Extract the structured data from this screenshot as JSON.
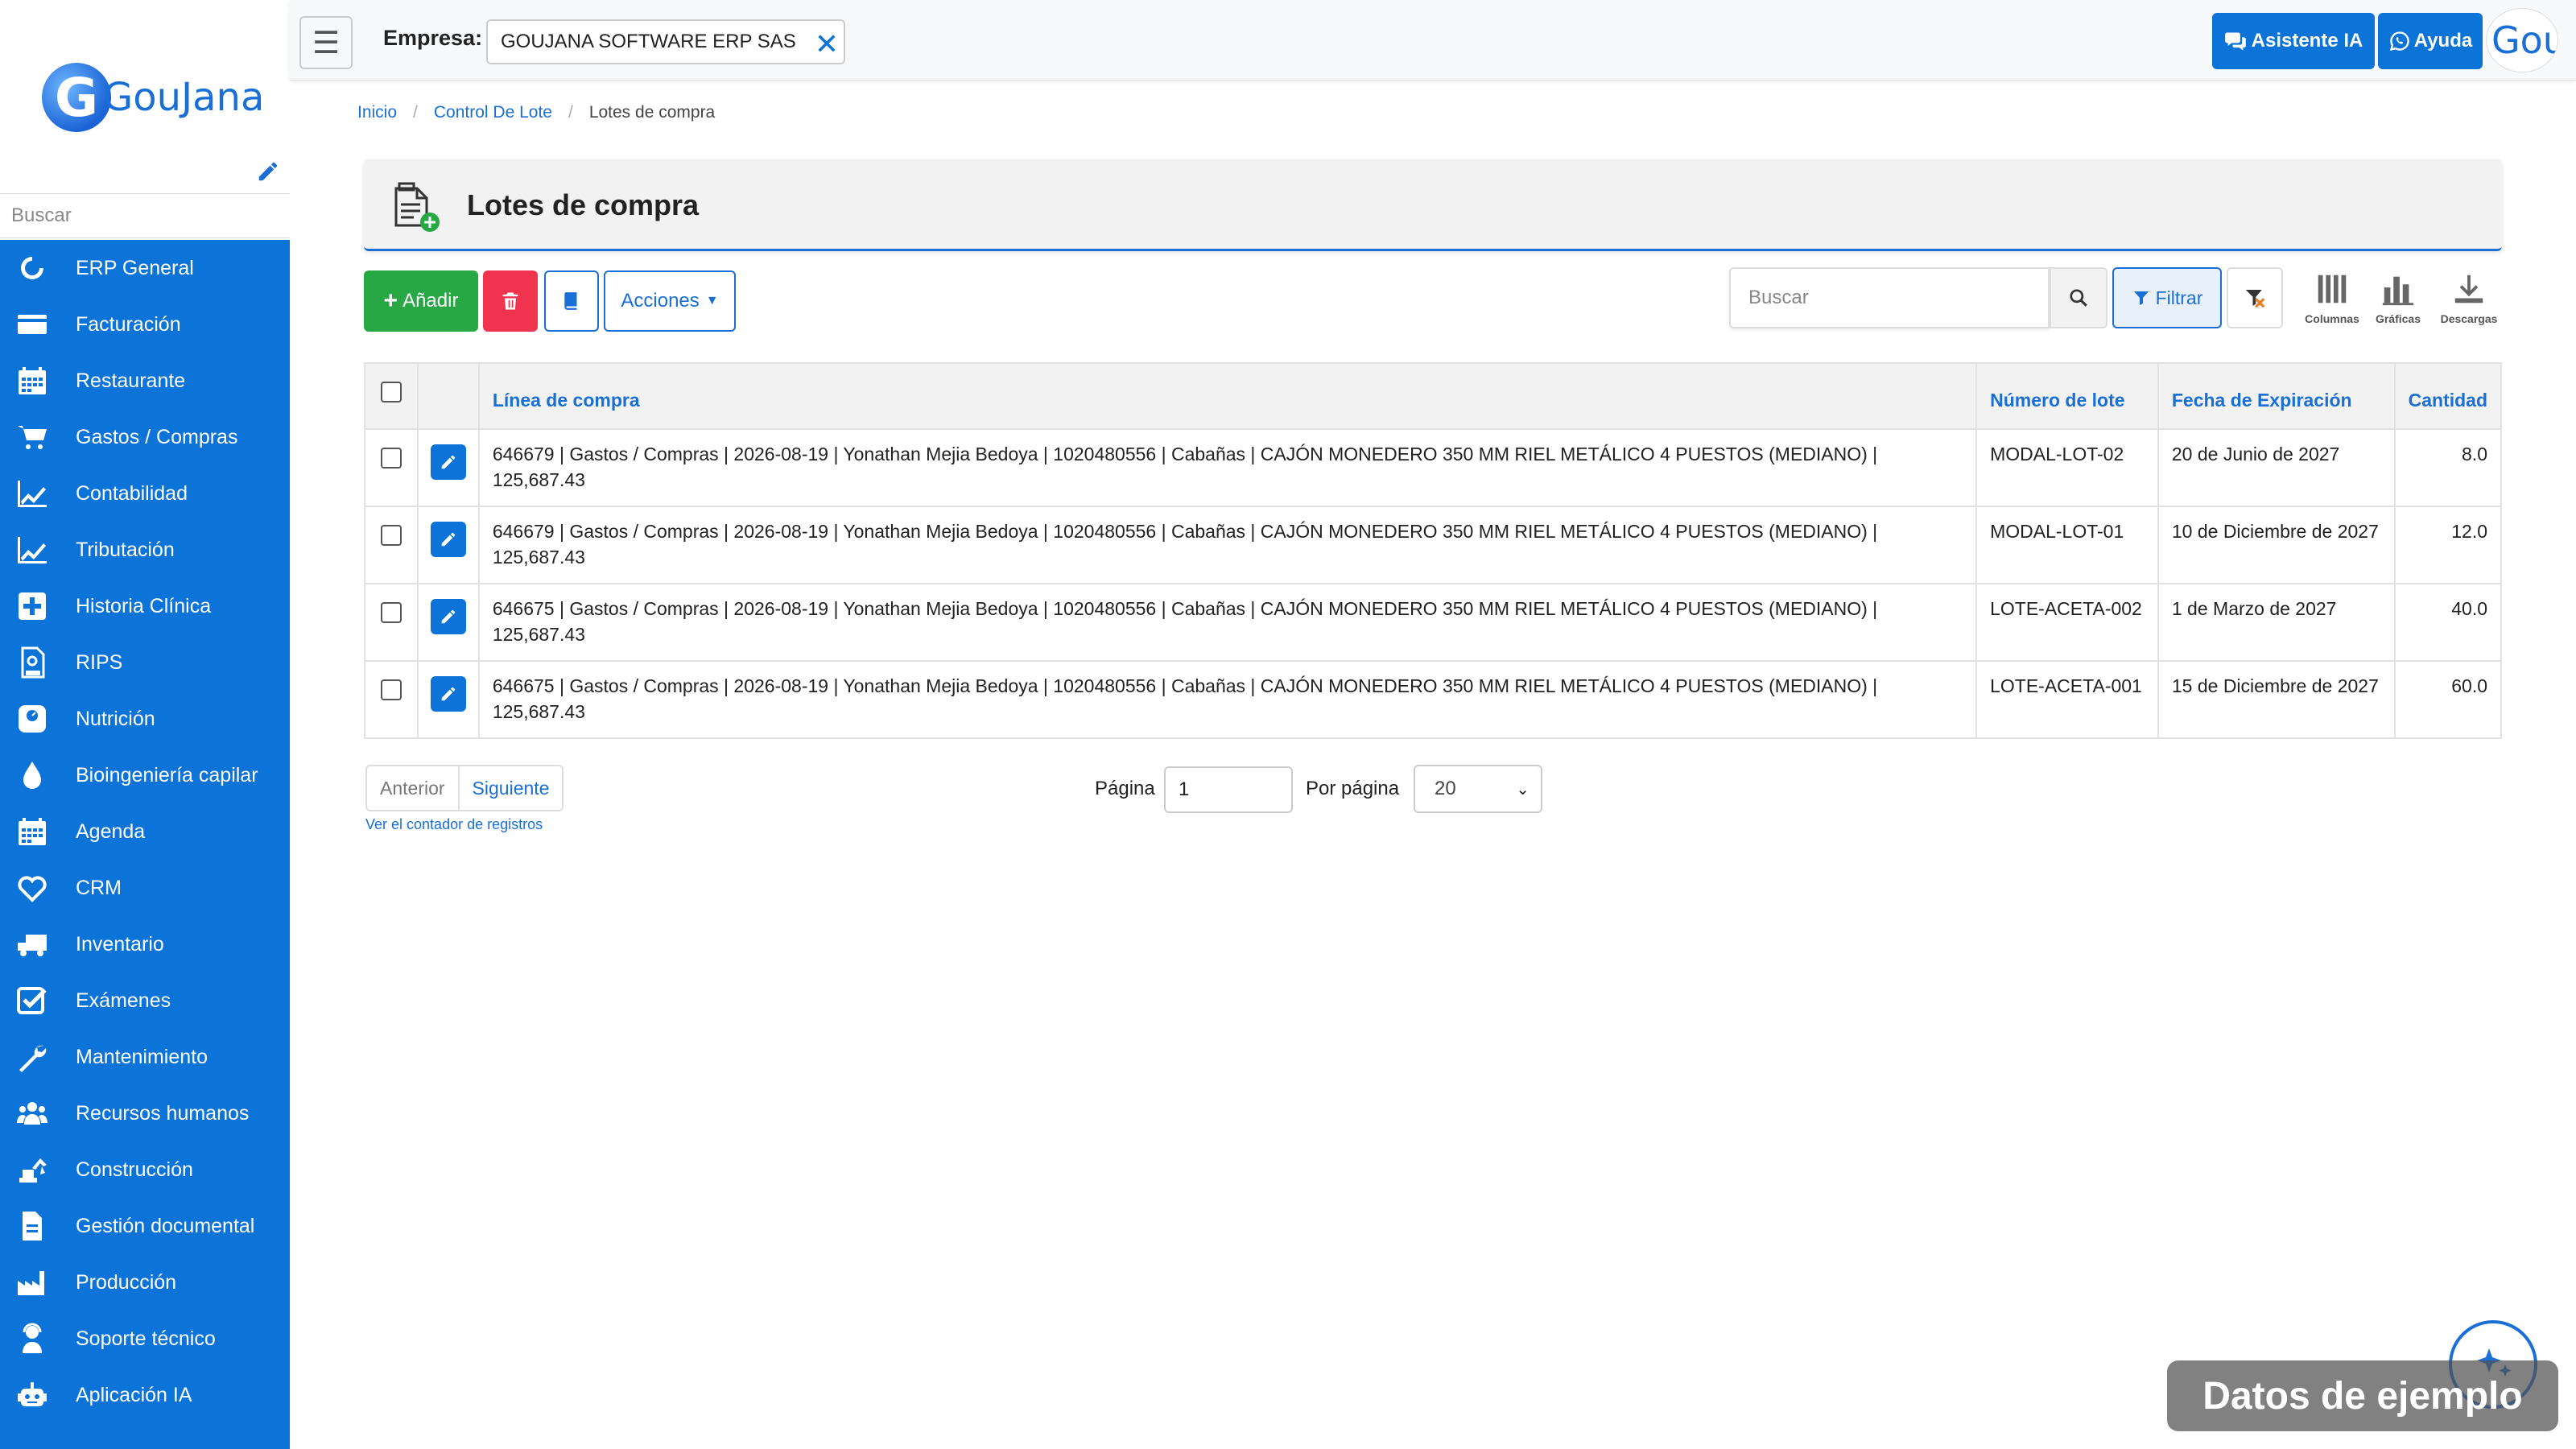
{
  "sidebar": {
    "logo_letter": "G",
    "logo_text": "GouJana",
    "search_placeholder": "Buscar",
    "items": [
      {
        "label": "ERP General",
        "icon": "circle-notch-icon"
      },
      {
        "label": "Facturación",
        "icon": "credit-card-icon"
      },
      {
        "label": "Restaurante",
        "icon": "calendar-icon"
      },
      {
        "label": "Gastos / Compras",
        "icon": "cart-icon"
      },
      {
        "label": "Contabilidad",
        "icon": "chart-line-icon"
      },
      {
        "label": "Tributación",
        "icon": "chart-line-icon"
      },
      {
        "label": "Historia Clínica",
        "icon": "plus-square-icon"
      },
      {
        "label": "RIPS",
        "icon": "rips-doc-icon"
      },
      {
        "label": "Nutrición",
        "icon": "scale-icon"
      },
      {
        "label": "Bioingeniería capilar",
        "icon": "drop-icon"
      },
      {
        "label": "Agenda",
        "icon": "calendar-icon"
      },
      {
        "label": "CRM",
        "icon": "heart-icon"
      },
      {
        "label": "Inventario",
        "icon": "truck-icon"
      },
      {
        "label": "Exámenes",
        "icon": "check-square-icon"
      },
      {
        "label": "Mantenimiento",
        "icon": "wrench-icon"
      },
      {
        "label": "Recursos humanos",
        "icon": "users-icon"
      },
      {
        "label": "Construcción",
        "icon": "excavator-icon"
      },
      {
        "label": "Gestión documental",
        "icon": "document-icon"
      },
      {
        "label": "Producción",
        "icon": "factory-icon"
      },
      {
        "label": "Soporte técnico",
        "icon": "support-agent-icon"
      },
      {
        "label": "Aplicación IA",
        "icon": "robot-icon"
      }
    ]
  },
  "topbar": {
    "empresa_label": "Empresa:",
    "empresa_value": "GOUJANA SOFTWARE ERP SAS",
    "ia_button": "Asistente IA",
    "help_button": "Ayuda",
    "avatar_text": "Gou"
  },
  "breadcrumb": {
    "items": [
      "Inicio",
      "Control De Lote"
    ],
    "current": "Lotes de compra"
  },
  "header": {
    "title": "Lotes de compra"
  },
  "toolbar": {
    "add_label": "Añadir",
    "actions_label": "Acciones",
    "search_placeholder": "Buscar",
    "filter_label": "Filtrar",
    "columns_label": "Columnas",
    "charts_label": "Gráficas",
    "downloads_label": "Descargas"
  },
  "table": {
    "columns": [
      "Línea de compra",
      "Número de lote",
      "Fecha de Expiración",
      "Cantidad"
    ],
    "rows": [
      {
        "linea": "646679 | Gastos / Compras | 2026-08-19 | Yonathan Mejia Bedoya | 1020480556 | Cabañas | CAJÓN MONEDERO 350 MM RIEL METÁLICO 4 PUESTOS (MEDIANO) | 125,687.43",
        "lote": "MODAL-LOT-02",
        "fecha": "20 de Junio de 2027",
        "cantidad": "8.0"
      },
      {
        "linea": "646679 | Gastos / Compras | 2026-08-19 | Yonathan Mejia Bedoya | 1020480556 | Cabañas | CAJÓN MONEDERO 350 MM RIEL METÁLICO 4 PUESTOS (MEDIANO) | 125,687.43",
        "lote": "MODAL-LOT-01",
        "fecha": "10 de Diciembre de 2027",
        "cantidad": "12.0"
      },
      {
        "linea": "646675 | Gastos / Compras | 2026-08-19 | Yonathan Mejia Bedoya | 1020480556 | Cabañas | CAJÓN MONEDERO 350 MM RIEL METÁLICO 4 PUESTOS (MEDIANO) | 125,687.43",
        "lote": "LOTE-ACETA-002",
        "fecha": "1 de Marzo de 2027",
        "cantidad": "40.0"
      },
      {
        "linea": "646675 | Gastos / Compras | 2026-08-19 | Yonathan Mejia Bedoya | 1020480556 | Cabañas | CAJÓN MONEDERO 350 MM RIEL METÁLICO 4 PUESTOS (MEDIANO) | 125,687.43",
        "lote": "LOTE-ACETA-001",
        "fecha": "15 de Diciembre de 2027",
        "cantidad": "60.0"
      }
    ]
  },
  "pagination": {
    "prev_label": "Anterior",
    "next_label": "Siguiente",
    "counter_link": "Ver el contador de registros",
    "page_label": "Página",
    "page_value": "1",
    "per_page_label": "Por página",
    "per_page_value": "20"
  },
  "watermark": {
    "text": "Datos de ejemplo"
  },
  "colors": {
    "primary": "#0c73d8",
    "success": "#28a745",
    "danger": "#f0344f"
  }
}
